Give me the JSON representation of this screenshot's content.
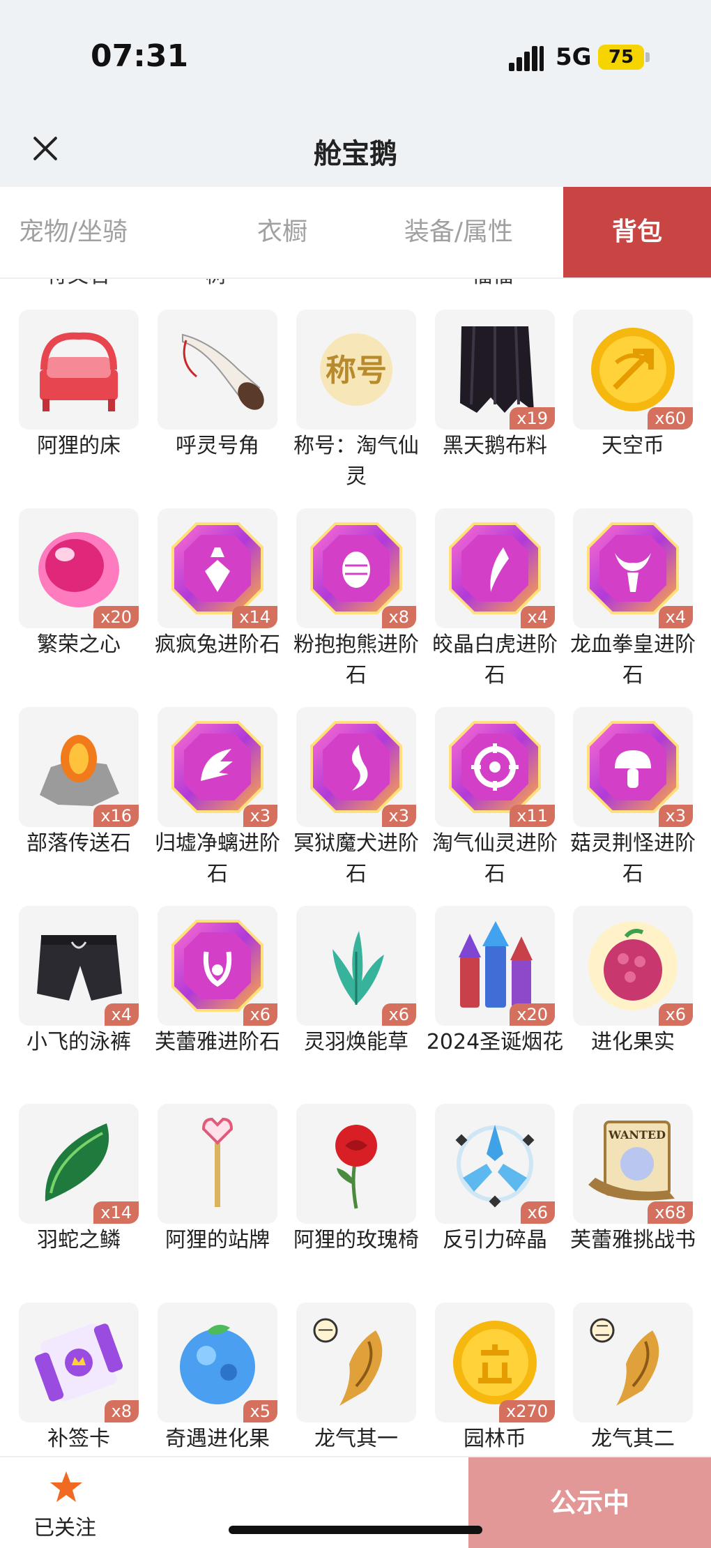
{
  "status": {
    "time": "07:31",
    "network": "5G",
    "battery": "75"
  },
  "header": {
    "title": "舱宝鹅"
  },
  "tabs": [
    {
      "label": "宠物/坐骑",
      "active": false
    },
    {
      "label": "衣橱",
      "active": false
    },
    {
      "label": "装备/属性",
      "active": false
    },
    {
      "label": "背包",
      "active": true
    }
  ],
  "partial_row": [
    "符文石",
    "树",
    "",
    "福福",
    ""
  ],
  "items": [
    {
      "label": "阿狸的床",
      "count": "",
      "icon": "bed-icon"
    },
    {
      "label": "呼灵号角",
      "count": "",
      "icon": "horn-icon"
    },
    {
      "label": "称号：淘气仙灵",
      "count": "",
      "icon": "title-badge-icon",
      "icon_text": "称号"
    },
    {
      "label": "黑天鹅布料",
      "count": "x19",
      "icon": "black-cloth-icon"
    },
    {
      "label": "天空币",
      "count": "x60",
      "icon": "sky-coin-icon"
    },
    {
      "label": "繁荣之心",
      "count": "x20",
      "icon": "pink-heart-gem-icon"
    },
    {
      "label": "疯疯兔进阶石",
      "count": "x14",
      "icon": "gem-carrot-icon"
    },
    {
      "label": "粉抱抱熊进阶石",
      "count": "x8",
      "icon": "gem-egg-icon"
    },
    {
      "label": "皎晶白虎进阶石",
      "count": "x4",
      "icon": "gem-claw-icon"
    },
    {
      "label": "龙血拳皇进阶石",
      "count": "x4",
      "icon": "gem-horns-icon"
    },
    {
      "label": "部落传送石",
      "count": "x16",
      "icon": "teleport-stone-icon"
    },
    {
      "label": "归墟净螭进阶石",
      "count": "x3",
      "icon": "gem-wing-icon"
    },
    {
      "label": "冥狱魔犬进阶石",
      "count": "x3",
      "icon": "gem-flame-icon"
    },
    {
      "label": "淘气仙灵进阶石",
      "count": "x11",
      "icon": "gem-circle-icon"
    },
    {
      "label": "菇灵荆怪进阶石",
      "count": "x3",
      "icon": "gem-mushroom-icon"
    },
    {
      "label": "小飞的泳裤",
      "count": "x4",
      "icon": "swim-shorts-icon"
    },
    {
      "label": "芙蕾雅进阶石",
      "count": "x6",
      "icon": "gem-crest-icon"
    },
    {
      "label": "灵羽焕能草",
      "count": "x6",
      "icon": "feather-grass-icon"
    },
    {
      "label": "2024圣诞烟花",
      "count": "x20",
      "icon": "fireworks-icon"
    },
    {
      "label": "进化果实",
      "count": "x6",
      "icon": "evolution-fruit-icon"
    },
    {
      "label": "羽蛇之鳞",
      "count": "x14",
      "icon": "green-scale-icon"
    },
    {
      "label": "阿狸的站牌",
      "count": "",
      "icon": "sign-pole-icon"
    },
    {
      "label": "阿狸的玫瑰椅",
      "count": "",
      "icon": "rose-icon"
    },
    {
      "label": "反引力碎晶",
      "count": "x6",
      "icon": "crystal-shard-icon"
    },
    {
      "label": "芙蕾雅挑战书",
      "count": "x68",
      "icon": "wanted-scroll-icon",
      "icon_text": "WANTED"
    },
    {
      "label": "补签卡",
      "count": "x8",
      "icon": "sign-card-icon"
    },
    {
      "label": "奇遇进化果",
      "count": "x5",
      "icon": "blue-fruit-icon"
    },
    {
      "label": "龙气其一",
      "count": "",
      "icon": "dragon-claw-one-icon",
      "icon_text": "一"
    },
    {
      "label": "园林币",
      "count": "x270",
      "icon": "garden-coin-icon"
    },
    {
      "label": "龙气其二",
      "count": "",
      "icon": "dragon-claw-two-icon",
      "icon_text": "二"
    }
  ],
  "footer": {
    "follow_label": "已关注",
    "public_label": "公示中"
  }
}
